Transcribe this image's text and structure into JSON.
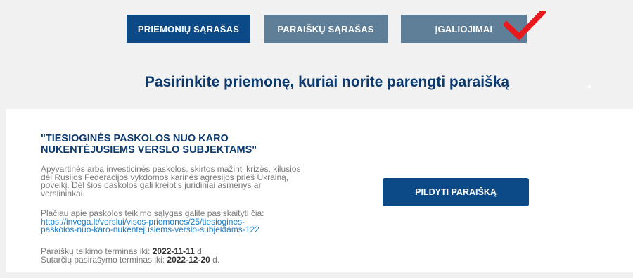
{
  "tabs": [
    {
      "label": "PRIEMONIŲ SĄRAŠAS",
      "active": true
    },
    {
      "label": "PARAIŠKŲ SĄRAŠAS",
      "active": false
    },
    {
      "label": "ĮGALIOJIMAI",
      "active": false
    }
  ],
  "heading": "Pasirinkite priemonę, kuriai norite parengti paraišką",
  "measure": {
    "title": "\"TIESIOGINĖS PASKOLOS NUO KARO NUKENTĖJUSIEMS VERSLO SUBJEKTAMS\"",
    "description": "Apyvartinės arba investicinės paskolos, skirtos mažinti krizės, kilusios dėl Rusijos Federacijos vykdomos karinės agresijos prieš Ukrainą, poveikį. Dėl šios paskolos gali kreiptis juridiniai asmenys ar verslininkai.",
    "more_info_text": "Plačiau apie paskolos teikimo sąlygas galite pasiskaityti čia:",
    "more_info_link": "https://invega.lt/verslui/visos-priemones/25/tiesiogines-paskolos-nuo-karo-nukentejusiems-verslo-subjektams-122",
    "application_deadline_label": "Paraiškų teikimo terminas iki:",
    "application_deadline": "2022-11-11",
    "contract_deadline_label": "Sutarčių pasirašymo terminas iki:",
    "contract_deadline": "2022-12-20",
    "day_suffix": "d.",
    "fill_button": "PILDYTI PARAIŠKĄ"
  },
  "colors": {
    "active_tab": "#0b4a86",
    "inactive_tab": "#5f7f98",
    "heading": "#0c3a6e",
    "link": "#1a7ec8",
    "checkmark": "#e8191c"
  },
  "icons": {
    "annotation": "red-checkmark-icon"
  }
}
